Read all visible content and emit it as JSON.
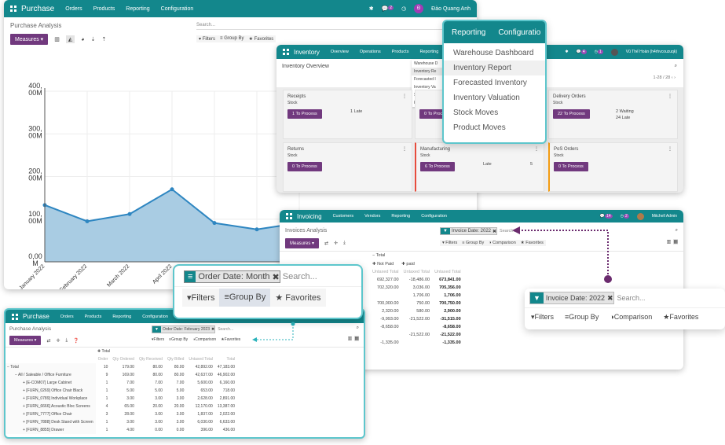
{
  "purchase": {
    "app": "Purchase",
    "menu": [
      "Orders",
      "Products",
      "Reporting",
      "Configuration"
    ],
    "chat_badge": "2",
    "user_initial": "Đ",
    "user": "Đào Quang Anh",
    "title": "Purchase Analysis",
    "measures": "Measures",
    "search_placeholder": "Search...",
    "filters": "Filters",
    "group_by": "Group By",
    "favorites": "Favorites"
  },
  "chart_data": {
    "type": "area",
    "categories": [
      "January 2022",
      "February 2022",
      "March 2022",
      "April 2022"
    ],
    "values": [
      133,
      95,
      112,
      170,
      91,
      76,
      91
    ],
    "unit": "M",
    "yticks": [
      "0,00 M",
      "100, 00M",
      "200, 00M",
      "300, 00M",
      "400, 00M"
    ],
    "ylim": [
      0,
      400
    ],
    "grid": true,
    "color": "#2e86c1"
  },
  "inventory": {
    "app": "Inventory",
    "menu": [
      "Overview",
      "Operations",
      "Products",
      "Reporting"
    ],
    "chat_badge": "4",
    "activity_badge": "1",
    "user": "Vũ Thế Hoàn (h4rhvcouzuqk)",
    "title": "Inventory Overview",
    "pager": "1-28 / 28",
    "small_menu": [
      "Warehouse D",
      "Inventory Re",
      "Forecasted I",
      "Inventory Va",
      "Stock Moves",
      "Product Mo"
    ],
    "cards": [
      {
        "title": "Receipts",
        "sub": "Stock",
        "button": "1 To Process",
        "info": "1 Late"
      },
      {
        "title": "",
        "sub": "",
        "button": "0 To Proc",
        "info": ""
      },
      {
        "title": "Delivery Orders",
        "sub": "Stock",
        "button": "22 To Process",
        "info": "2 Waiting",
        "info2": "24 Late"
      },
      {
        "title": "Returns",
        "sub": "Stock",
        "button": "0 To Process",
        "info": ""
      },
      {
        "title": "Manufacturing",
        "sub": "Stock",
        "button": "6 To Process",
        "info": "Late",
        "count": "5"
      },
      {
        "title": "PoS Orders",
        "sub": "Stock",
        "button": "0 To Process",
        "info": ""
      }
    ]
  },
  "reporting_menu": {
    "tabs": [
      "Reporting",
      "Configuratio"
    ],
    "items": [
      "Warehouse Dashboard",
      "Inventory Report",
      "Forecasted Inventory",
      "Inventory Valuation",
      "Stock Moves",
      "Product Moves"
    ]
  },
  "invoicing": {
    "app": "Invoicing",
    "menu": [
      "Customers",
      "Vendors",
      "Reporting",
      "Configuration"
    ],
    "chat_badge": "14",
    "activity_badge": "2",
    "user": "Mitchell Admin",
    "title": "Invoices Analysis",
    "measures": "Measures",
    "facet": "Invoice Date: 2022",
    "search_placeholder": "Search...",
    "filters": "Filters",
    "group_by": "Group By",
    "comparison": "Comparison",
    "favorites": "Favorites",
    "pivot": {
      "total": "Total",
      "groups": [
        "Not Paid",
        "paid"
      ],
      "headers": [
        "Untaxed Total",
        "Untaxed Total",
        "Untaxed Total"
      ],
      "rows": [
        [
          "692,327.00",
          "-18,486.00",
          "673,841.00"
        ],
        [
          "702,320.00",
          "3,036.00",
          "705,356.00"
        ],
        [
          "",
          "1,706.00",
          "1,706.00"
        ],
        [
          "700,000.00",
          "750.00",
          "700,750.00"
        ],
        [
          "2,320.00",
          "580.00",
          "2,900.00"
        ],
        [
          "-9,993.00",
          "-21,522.00",
          "-31,515.00"
        ],
        [
          "-8,658.00",
          "",
          "-8,658.00"
        ],
        [
          "",
          "-21,522.00",
          "-21,522.00"
        ],
        [
          "-1,335.00",
          "",
          "-1,335.00"
        ]
      ]
    }
  },
  "invoice_callout": {
    "facet": "Invoice Date: 2022",
    "search_placeholder": "Search...",
    "filters": "Filters",
    "group_by": "Group By",
    "comparison": "Comparison",
    "favorites": "Favorites"
  },
  "order_callout": {
    "facet": "Order Date: Month",
    "search_placeholder": "Search...",
    "filters": "Filters",
    "group_by": "Group By",
    "favorites": "Favorites"
  },
  "purchase_pivot": {
    "app": "Purchase",
    "menu": [
      "Orders",
      "Products",
      "Reporting",
      "Configuration"
    ],
    "title": "Purchase Analysis",
    "measures": "Measures",
    "facet": "Order Date: February 2023",
    "search_placeholder": "Search...",
    "filters": "Filters",
    "group_by": "Group By",
    "comparison": "Comparison",
    "favorites": "Favorites",
    "col_total": "Total",
    "headers": [
      "Order",
      "Qty Ordered",
      "Qty Received",
      "Qty Billed",
      "Untaxed Total",
      "Total"
    ],
    "rows": [
      {
        "label": "Total",
        "level": 0,
        "sign": "−",
        "v": [
          "10",
          "179.00",
          "80.00",
          "80.00",
          "42,892.00",
          "47,183.00"
        ]
      },
      {
        "label": "All / Saleable / Office Furniture",
        "level": 1,
        "sign": "−",
        "v": [
          "9",
          "169.00",
          "80.00",
          "80.00",
          "42,637.00",
          "46,902.00"
        ]
      },
      {
        "label": "[E-COM07] Large Cabinet",
        "level": 2,
        "sign": "+",
        "v": [
          "1",
          "7.00",
          "7.00",
          "7.00",
          "5,600.00",
          "6,160.00"
        ]
      },
      {
        "label": "[FURN_0269] Office Chair Black",
        "level": 2,
        "sign": "+",
        "v": [
          "1",
          "5.00",
          "5.00",
          "5.00",
          "653.00",
          "718.00"
        ]
      },
      {
        "label": "[FURN_0789] Individual Workplace",
        "level": 2,
        "sign": "+",
        "v": [
          "1",
          "3.00",
          "3.00",
          "3.00",
          "2,628.00",
          "2,891.00"
        ]
      },
      {
        "label": "[FURN_6666] Acoustic Bloc Screens",
        "level": 2,
        "sign": "+",
        "v": [
          "4",
          "65.00",
          "20.00",
          "20.00",
          "12,170.00",
          "13,387.00"
        ]
      },
      {
        "label": "[FURN_7777] Office Chair",
        "level": 2,
        "sign": "+",
        "v": [
          "3",
          "28.00",
          "3.00",
          "3.00",
          "1,837.00",
          "2,022.00"
        ]
      },
      {
        "label": "[FURN_7888] Desk Stand with Screen",
        "level": 2,
        "sign": "+",
        "v": [
          "1",
          "3.00",
          "3.00",
          "3.00",
          "6,030.00",
          "6,633.00"
        ]
      },
      {
        "label": "[FURN_8855] Drawer",
        "level": 2,
        "sign": "+",
        "v": [
          "1",
          "4.00",
          "0.00",
          "0.00",
          "396.00",
          "436.00"
        ]
      }
    ]
  }
}
